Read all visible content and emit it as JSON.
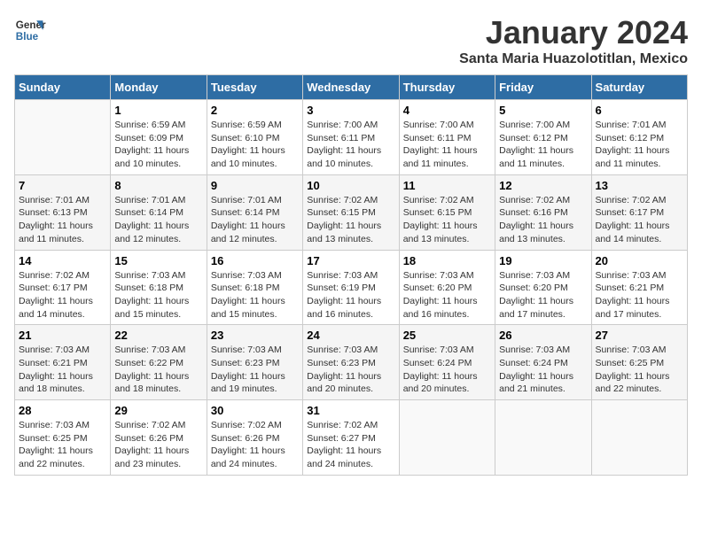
{
  "logo": {
    "line1": "General",
    "line2": "Blue"
  },
  "title": "January 2024",
  "location": "Santa Maria Huazolotitlan, Mexico",
  "days_of_week": [
    "Sunday",
    "Monday",
    "Tuesday",
    "Wednesday",
    "Thursday",
    "Friday",
    "Saturday"
  ],
  "weeks": [
    [
      {
        "day": "",
        "info": ""
      },
      {
        "day": "1",
        "info": "Sunrise: 6:59 AM\nSunset: 6:09 PM\nDaylight: 11 hours\nand 10 minutes."
      },
      {
        "day": "2",
        "info": "Sunrise: 6:59 AM\nSunset: 6:10 PM\nDaylight: 11 hours\nand 10 minutes."
      },
      {
        "day": "3",
        "info": "Sunrise: 7:00 AM\nSunset: 6:11 PM\nDaylight: 11 hours\nand 10 minutes."
      },
      {
        "day": "4",
        "info": "Sunrise: 7:00 AM\nSunset: 6:11 PM\nDaylight: 11 hours\nand 11 minutes."
      },
      {
        "day": "5",
        "info": "Sunrise: 7:00 AM\nSunset: 6:12 PM\nDaylight: 11 hours\nand 11 minutes."
      },
      {
        "day": "6",
        "info": "Sunrise: 7:01 AM\nSunset: 6:12 PM\nDaylight: 11 hours\nand 11 minutes."
      }
    ],
    [
      {
        "day": "7",
        "info": "Sunrise: 7:01 AM\nSunset: 6:13 PM\nDaylight: 11 hours\nand 11 minutes."
      },
      {
        "day": "8",
        "info": "Sunrise: 7:01 AM\nSunset: 6:14 PM\nDaylight: 11 hours\nand 12 minutes."
      },
      {
        "day": "9",
        "info": "Sunrise: 7:01 AM\nSunset: 6:14 PM\nDaylight: 11 hours\nand 12 minutes."
      },
      {
        "day": "10",
        "info": "Sunrise: 7:02 AM\nSunset: 6:15 PM\nDaylight: 11 hours\nand 13 minutes."
      },
      {
        "day": "11",
        "info": "Sunrise: 7:02 AM\nSunset: 6:15 PM\nDaylight: 11 hours\nand 13 minutes."
      },
      {
        "day": "12",
        "info": "Sunrise: 7:02 AM\nSunset: 6:16 PM\nDaylight: 11 hours\nand 13 minutes."
      },
      {
        "day": "13",
        "info": "Sunrise: 7:02 AM\nSunset: 6:17 PM\nDaylight: 11 hours\nand 14 minutes."
      }
    ],
    [
      {
        "day": "14",
        "info": "Sunrise: 7:02 AM\nSunset: 6:17 PM\nDaylight: 11 hours\nand 14 minutes."
      },
      {
        "day": "15",
        "info": "Sunrise: 7:03 AM\nSunset: 6:18 PM\nDaylight: 11 hours\nand 15 minutes."
      },
      {
        "day": "16",
        "info": "Sunrise: 7:03 AM\nSunset: 6:18 PM\nDaylight: 11 hours\nand 15 minutes."
      },
      {
        "day": "17",
        "info": "Sunrise: 7:03 AM\nSunset: 6:19 PM\nDaylight: 11 hours\nand 16 minutes."
      },
      {
        "day": "18",
        "info": "Sunrise: 7:03 AM\nSunset: 6:20 PM\nDaylight: 11 hours\nand 16 minutes."
      },
      {
        "day": "19",
        "info": "Sunrise: 7:03 AM\nSunset: 6:20 PM\nDaylight: 11 hours\nand 17 minutes."
      },
      {
        "day": "20",
        "info": "Sunrise: 7:03 AM\nSunset: 6:21 PM\nDaylight: 11 hours\nand 17 minutes."
      }
    ],
    [
      {
        "day": "21",
        "info": "Sunrise: 7:03 AM\nSunset: 6:21 PM\nDaylight: 11 hours\nand 18 minutes."
      },
      {
        "day": "22",
        "info": "Sunrise: 7:03 AM\nSunset: 6:22 PM\nDaylight: 11 hours\nand 18 minutes."
      },
      {
        "day": "23",
        "info": "Sunrise: 7:03 AM\nSunset: 6:23 PM\nDaylight: 11 hours\nand 19 minutes."
      },
      {
        "day": "24",
        "info": "Sunrise: 7:03 AM\nSunset: 6:23 PM\nDaylight: 11 hours\nand 20 minutes."
      },
      {
        "day": "25",
        "info": "Sunrise: 7:03 AM\nSunset: 6:24 PM\nDaylight: 11 hours\nand 20 minutes."
      },
      {
        "day": "26",
        "info": "Sunrise: 7:03 AM\nSunset: 6:24 PM\nDaylight: 11 hours\nand 21 minutes."
      },
      {
        "day": "27",
        "info": "Sunrise: 7:03 AM\nSunset: 6:25 PM\nDaylight: 11 hours\nand 22 minutes."
      }
    ],
    [
      {
        "day": "28",
        "info": "Sunrise: 7:03 AM\nSunset: 6:25 PM\nDaylight: 11 hours\nand 22 minutes."
      },
      {
        "day": "29",
        "info": "Sunrise: 7:02 AM\nSunset: 6:26 PM\nDaylight: 11 hours\nand 23 minutes."
      },
      {
        "day": "30",
        "info": "Sunrise: 7:02 AM\nSunset: 6:26 PM\nDaylight: 11 hours\nand 24 minutes."
      },
      {
        "day": "31",
        "info": "Sunrise: 7:02 AM\nSunset: 6:27 PM\nDaylight: 11 hours\nand 24 minutes."
      },
      {
        "day": "",
        "info": ""
      },
      {
        "day": "",
        "info": ""
      },
      {
        "day": "",
        "info": ""
      }
    ]
  ]
}
